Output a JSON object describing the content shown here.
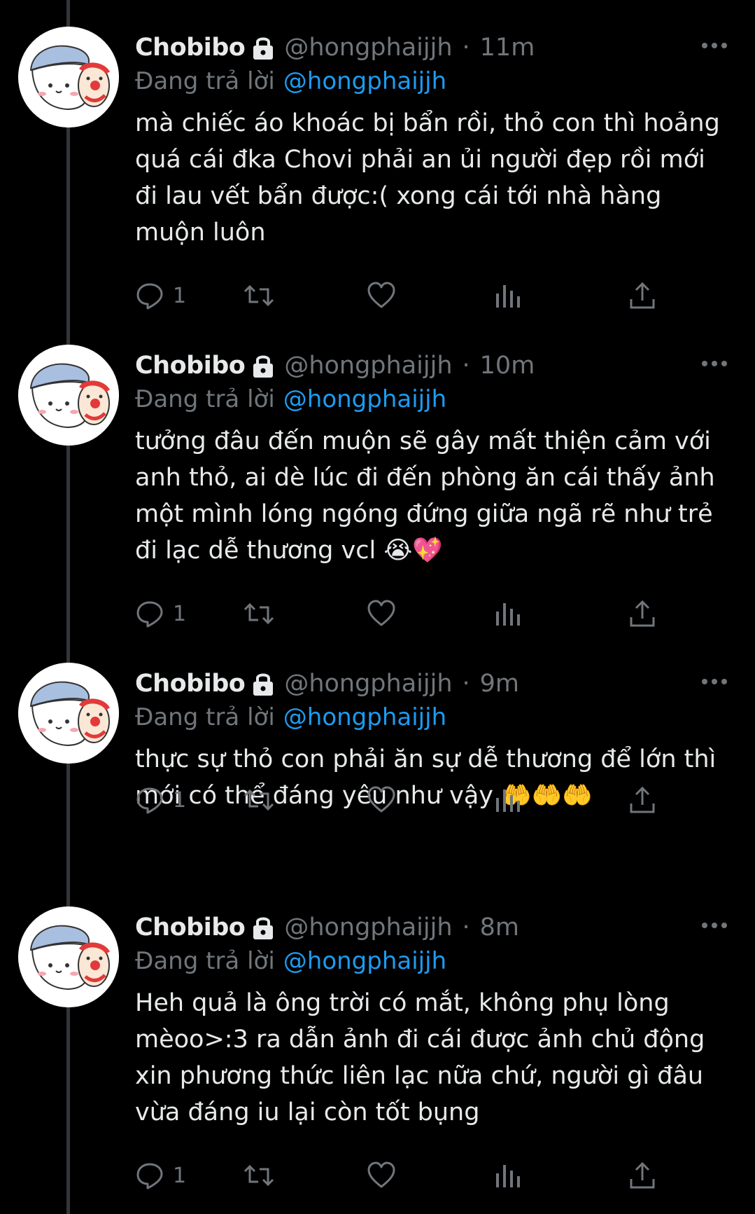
{
  "colors": {
    "background": "#000000",
    "text": "#e7e9ea",
    "muted": "#71767b",
    "mention": "#1d9bf0",
    "thread_line": "#333639"
  },
  "tweets": [
    {
      "display_name": "Chobibo",
      "handle": "@hongphaijjh",
      "dot": "·",
      "time": "11m",
      "reply_prefix": "Đang trả lời",
      "reply_mention": "@hongphaijjh",
      "lines": [
        "mà chiếc áo khoác bị bẩn rồi, thỏ con thì hoảng",
        "quá cái đka Chovi phải an ủi người đẹp rồi mới",
        "đi lau vết bẩn được:( xong cái tới nhà hàng",
        "muộn luôn"
      ],
      "reply_count": "1",
      "retweet_count": "",
      "like_count": ""
    },
    {
      "display_name": "Chobibo",
      "handle": "@hongphaijjh",
      "dot": "·",
      "time": "10m",
      "reply_prefix": "Đang trả lời",
      "reply_mention": "@hongphaijjh",
      "lines": [
        "tưởng đâu đến muộn sẽ gây mất thiện cảm với",
        "anh thỏ, ai dè lúc đi đến phòng ăn cái thấy ảnh",
        "một mình lóng ngóng đứng giữa ngã rẽ như trẻ",
        "đi lạc dễ thương vcl 😭💖"
      ],
      "reply_count": "1",
      "retweet_count": "",
      "like_count": ""
    },
    {
      "display_name": "Chobibo",
      "handle": "@hongphaijjh",
      "dot": "·",
      "time": "9m",
      "reply_prefix": "Đang trả lời",
      "reply_mention": "@hongphaijjh",
      "lines": [
        "thực sự thỏ con phải ăn sự dễ thương để lớn thì",
        "mới có thể đáng yêu như vậy 🤲🤲🤲"
      ],
      "reply_count": "1",
      "retweet_count": "",
      "like_count": ""
    },
    {
      "display_name": "Chobibo",
      "handle": "@hongphaijjh",
      "dot": "·",
      "time": "8m",
      "reply_prefix": "Đang trả lời",
      "reply_mention": "@hongphaijjh",
      "lines": [
        "Heh quả là ông trời có mắt, không phụ lòng",
        "mèoo>:3 ra dẫn ảnh đi cái được ảnh chủ động",
        "xin phương thức liên lạc nữa chứ, người gì đâu",
        "vừa đáng iu lại còn tốt bụng"
      ],
      "reply_count": "1",
      "retweet_count": "",
      "like_count": ""
    }
  ]
}
